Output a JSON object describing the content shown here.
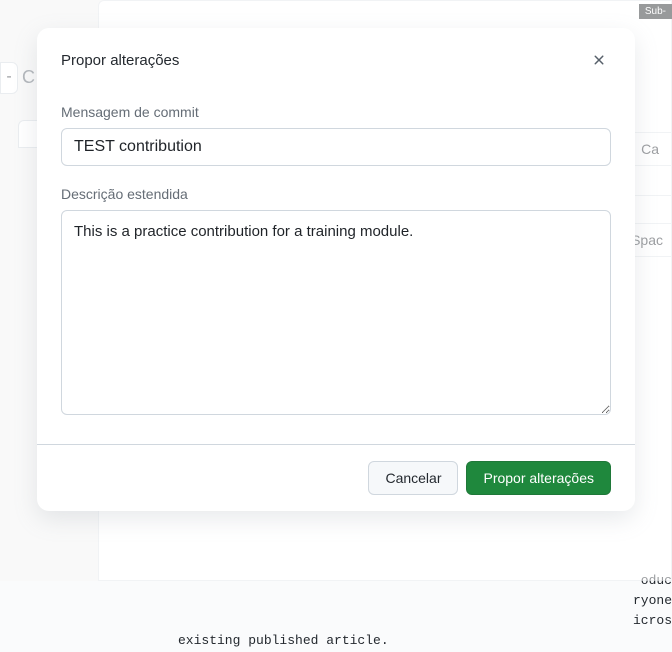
{
  "modal": {
    "title": "Propor alterações",
    "commit_label": "Mensagem de commit",
    "commit_value": "TEST contribution",
    "description_label": "Descrição estendida",
    "description_value": "This is a practice contribution for a training module.",
    "cancel_label": "Cancelar",
    "submit_label": "Propor alterações"
  },
  "background": {
    "submenu_text": "Sub-",
    "button1": "Ca",
    "button2": "Spac",
    "left_dash": "-",
    "left_c": "C",
    "code_fragment_1": "oduc",
    "code_fragment_2": "ryone",
    "code_fragment_3": "icros",
    "code_line": "existing published article."
  }
}
